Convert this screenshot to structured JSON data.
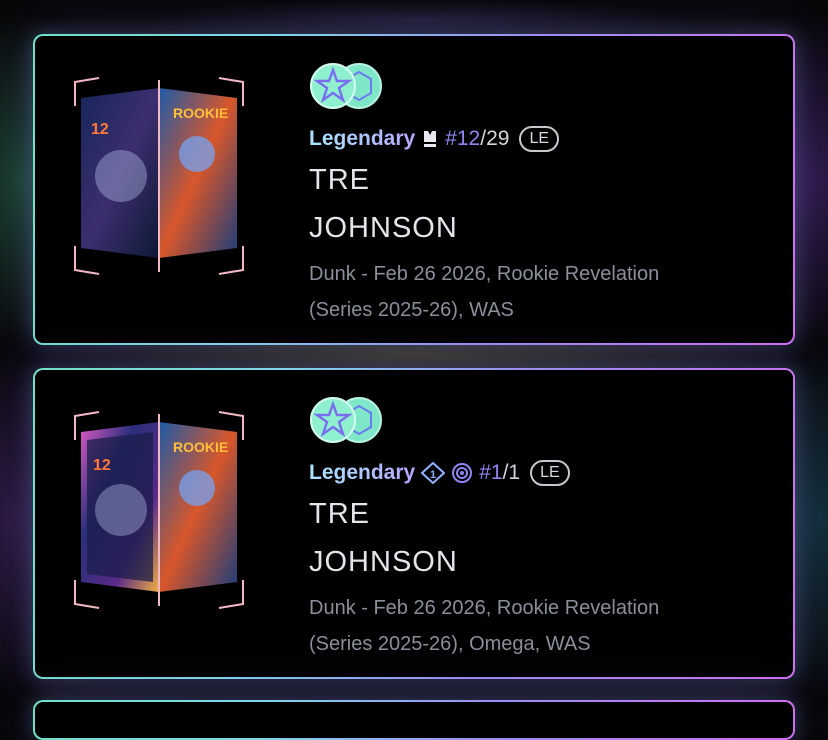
{
  "colors": {
    "card_border_start": "#6fe0c8",
    "card_border_end": "#d06ff0",
    "tier_text": "#b6a8ff",
    "serial_number": "#8f86f4",
    "description_text": "#8a8f9c",
    "badge_fill": "#7fe7c8"
  },
  "cards": [
    {
      "badge_icons": [
        "star-badge-icon",
        "cube-badge-icon"
      ],
      "tier": "Legendary",
      "tier_icon": "jersey-icon",
      "serial_hash_number": "#12",
      "serial_total": "/29",
      "edition_badge": "LE",
      "player_first": "TRE",
      "player_last": "JOHNSON",
      "description_line1": "Dunk - Feb 26 2026, Rookie Revelation",
      "description_line2": "(Series 2025-26), WAS"
    },
    {
      "badge_icons": [
        "star-badge-icon",
        "cube-badge-icon"
      ],
      "tier": "Legendary",
      "tier_icon": "serial-one-icon",
      "serial_hash_number": "#1",
      "serial_total": "/1",
      "edition_badge": "LE",
      "player_first": "TRE",
      "player_last": "JOHNSON",
      "description_line1": "Dunk - Feb 26 2026, Rookie Revelation",
      "description_line2": "(Series 2025-26), Omega, WAS"
    }
  ]
}
